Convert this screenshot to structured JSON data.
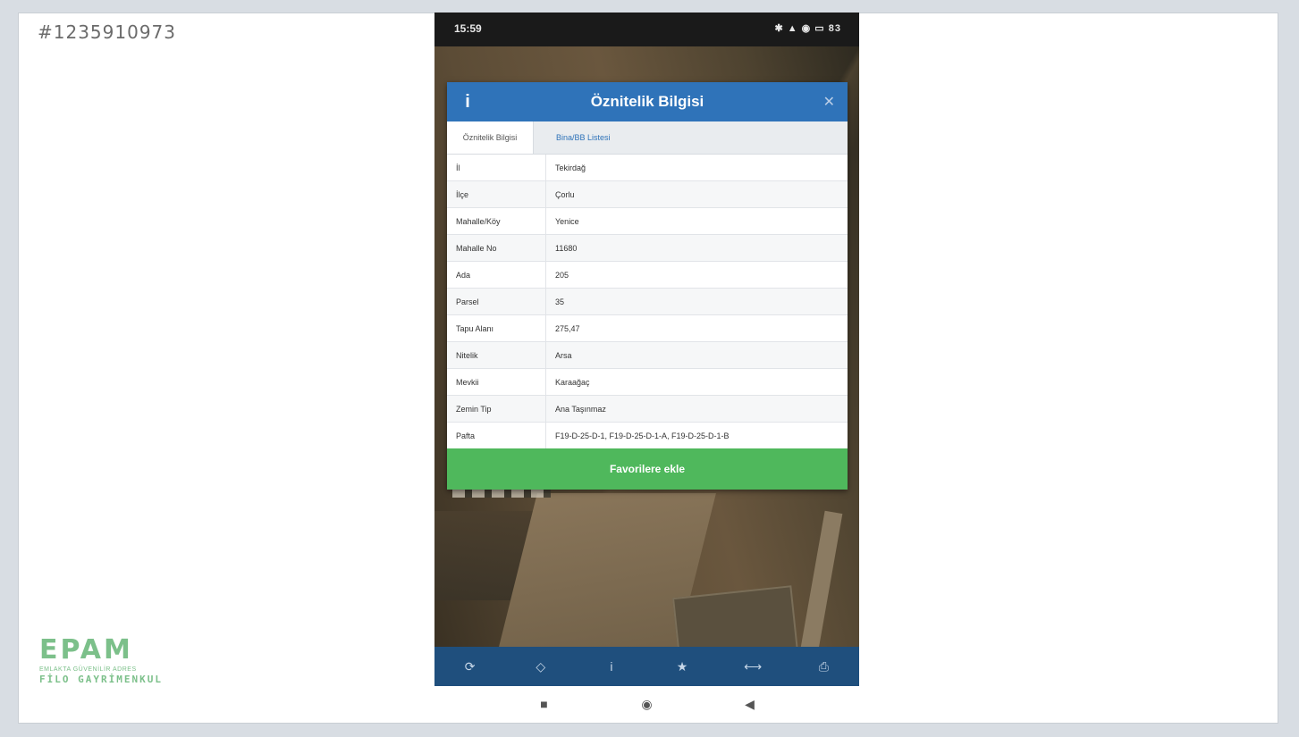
{
  "listing_id": "#1235910973",
  "logo": {
    "mark": "EPAM",
    "subtitle": "EMLAKTA GÜVENİLİR ADRES",
    "brand": "FİLO GAYRİMENKUL"
  },
  "status_bar": {
    "time": "15:59",
    "icons_text": "✱ ▲ ◉ ▭ 83"
  },
  "modal": {
    "title": "Öznitelik Bilgisi",
    "tabs": [
      {
        "label": "Öznitelik Bilgisi",
        "active": true
      },
      {
        "label": "Bina/BB Listesi",
        "active": false
      }
    ],
    "rows": [
      {
        "key": "İl",
        "value": "Tekirdağ"
      },
      {
        "key": "İlçe",
        "value": "Çorlu"
      },
      {
        "key": "Mahalle/Köy",
        "value": "Yenice"
      },
      {
        "key": "Mahalle No",
        "value": "11680"
      },
      {
        "key": "Ada",
        "value": "205"
      },
      {
        "key": "Parsel",
        "value": "35"
      },
      {
        "key": "Tapu Alanı",
        "value": "275,47"
      },
      {
        "key": "Nitelik",
        "value": "Arsa"
      },
      {
        "key": "Mevkii",
        "value": "Karaağaç"
      },
      {
        "key": "Zemin Tip",
        "value": "Ana Taşınmaz"
      },
      {
        "key": "Pafta",
        "value": "F19-D-25-D-1, F19-D-25-D-1-A, F19-D-25-D-1-B"
      }
    ],
    "favorite_button": "Favorilere ekle"
  },
  "toolbar": {
    "icons": [
      "refresh-icon",
      "location-icon",
      "info-icon",
      "star-icon",
      "measure-icon",
      "print-icon"
    ]
  },
  "colors": {
    "header": "#2f73b9",
    "button_green": "#4fb85c",
    "toolbar": "#1f4f7d"
  }
}
